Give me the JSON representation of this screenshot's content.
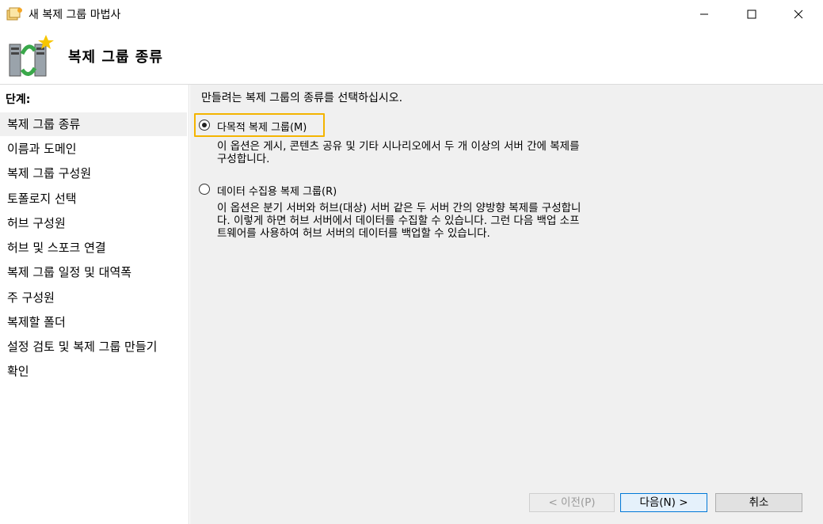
{
  "window": {
    "title": "새 복제 그룹 마법사"
  },
  "header": {
    "title": "복제 그룹 종류"
  },
  "sidebar": {
    "steps_title": "단계:",
    "items": [
      {
        "label": "복제 그룹 종류",
        "active": true
      },
      {
        "label": "이름과 도메인",
        "active": false
      },
      {
        "label": "복제 그룹 구성원",
        "active": false
      },
      {
        "label": "토폴로지 선택",
        "active": false
      },
      {
        "label": "허브 구성원",
        "active": false
      },
      {
        "label": "허브 및 스포크 연결",
        "active": false
      },
      {
        "label": "복제 그룹 일정 및 대역폭",
        "active": false
      },
      {
        "label": "주 구성원",
        "active": false
      },
      {
        "label": "복제할 폴더",
        "active": false
      },
      {
        "label": "설정 검토 및 복제 그룹 만들기",
        "active": false
      },
      {
        "label": "확인",
        "active": false
      }
    ]
  },
  "main": {
    "instruction": "만들려는 복제 그룹의 종류를 선택하십시오.",
    "options": [
      {
        "label": "다목적 복제 그룹(M)",
        "selected": true,
        "description": [
          "이 옵션은 게시, 콘텐츠 공유 및 기타 시나리오에서 두 개 이상의 서버 간에 복제를",
          "구성합니다."
        ]
      },
      {
        "label": "데이터 수집용 복제 그룹(R)",
        "selected": false,
        "description": [
          "이 옵션은 분기 서버와 허브(대상) 서버 같은 두 서버 간의 양방향 복제를 구성합니",
          "다. 이렇게 하면 허브 서버에서 데이터를 수집할 수 있습니다. 그런 다음 백업 소프",
          "트웨어를 사용하여 허브 서버의 데이터를 백업할 수 있습니다."
        ]
      }
    ]
  },
  "buttons": {
    "prev": "< 이전(P)",
    "next": "다음(N) >",
    "cancel": "취소"
  },
  "colors": {
    "highlight_border": "#f4b400",
    "panel_bg": "#f0f0f0",
    "default_button_border": "#0078d7"
  }
}
